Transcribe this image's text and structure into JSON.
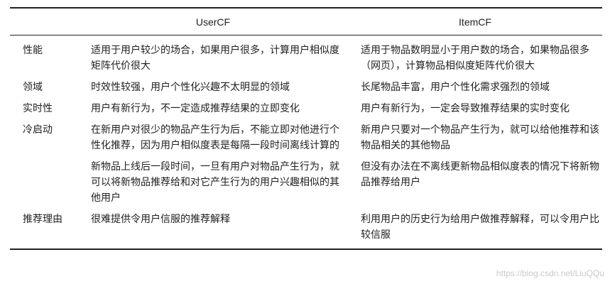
{
  "table": {
    "headers": [
      "",
      "UserCF",
      "ItemCF"
    ],
    "rows": [
      {
        "label": "性能",
        "usercf": "适用于用户较少的场合，如果用户很多，计算用户相似度矩阵代价很大",
        "itemcf": "适用于物品数明显小于用户数的场合，如果物品很多（网页），计算物品相似度矩阵代价很大"
      },
      {
        "label": "领域",
        "usercf": "时效性较强，用户个性化兴趣不太明显的领域",
        "itemcf": "长尾物品丰富，用户个性化需求强烈的领域"
      },
      {
        "label": "实时性",
        "usercf": "用户有新行为，不一定造成推荐结果的立即变化",
        "itemcf": "用户有新行为，一定会导致推荐结果的实时变化"
      },
      {
        "label": "冷启动",
        "usercf": "在新用户对很少的物品产生行为后，不能立即对他进行个性化推荐，因为用户相似度表是每隔一段时间离线计算的",
        "itemcf": "新用户只要对一个物品产生行为，就可以给他推荐和该物品相关的其他物品"
      },
      {
        "label": "",
        "usercf": "新物品上线后一段时间，一旦有用户对物品产生行为，就可以将新物品推荐给和对它产生行为的用户兴趣相似的其他用户",
        "itemcf": "但没有办法在不离线更新物品相似度表的情况下将新物品推荐给用户"
      },
      {
        "label": "推荐理由",
        "usercf": "很难提供令用户信服的推荐解释",
        "itemcf": "利用用户的历史行为给用户做推荐解释，可以令用户比较信服"
      }
    ]
  },
  "watermark": "https://blog.csdn.net/LiuQQu"
}
